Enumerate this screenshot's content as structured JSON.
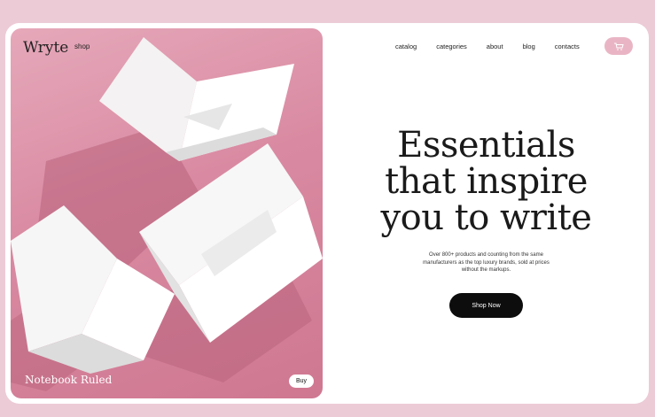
{
  "header": {
    "brand": "Wryte",
    "shop_label": "shop",
    "nav": [
      "catalog",
      "categories",
      "about",
      "blog",
      "contacts"
    ]
  },
  "hero": {
    "headline_lines": [
      "Essentials",
      "that inspire",
      "you to write"
    ],
    "subtext_lines": [
      "Over 800+ products and counting from the same",
      "manufacturers as the top luxury brands, sold at prices",
      "without the markups."
    ],
    "cta_label": "Shop Now"
  },
  "product": {
    "name": "Notebook Ruled",
    "buy_label": "Buy"
  },
  "icons": {
    "cart": "cart-icon"
  },
  "colors": {
    "background": "#eccbd6",
    "image_pink": "#d98aa2",
    "cart_button": "#e9b5c4",
    "cta": "#0d0d0d"
  }
}
